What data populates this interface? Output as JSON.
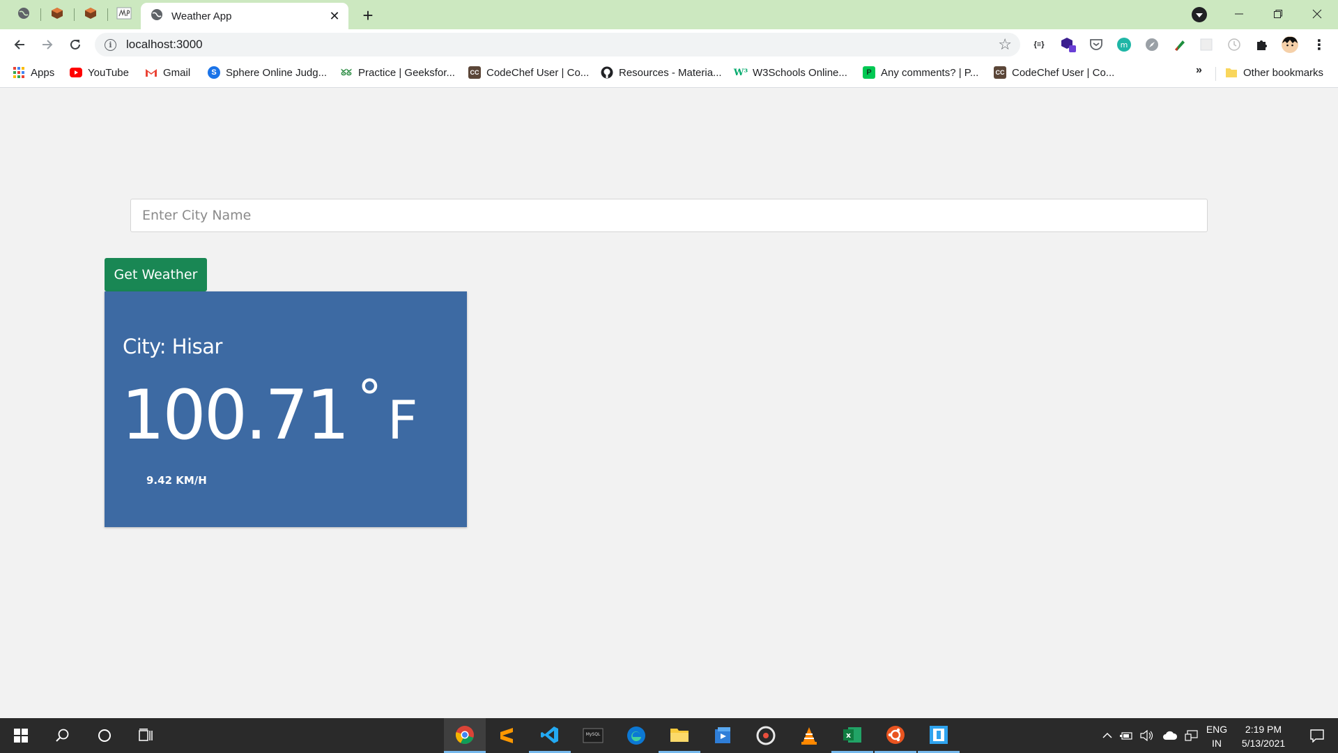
{
  "browser": {
    "active_tab_title": "Weather App",
    "new_tab_symbol": "+",
    "close_symbol": "✕",
    "url": "localhost:3000"
  },
  "bookmarks": {
    "items": [
      {
        "label": "Apps",
        "icon": "apps-grid-icon",
        "color": "#4285f4"
      },
      {
        "label": "YouTube",
        "icon": "youtube-icon",
        "color": "#ff0000"
      },
      {
        "label": "Gmail",
        "icon": "gmail-icon",
        "color": "#ea4335"
      },
      {
        "label": "Sphere Online Judg...",
        "icon": "sphere-judge-icon",
        "color": "#1a73e8"
      },
      {
        "label": "Practice | Geeksfor...",
        "icon": "geeksforgeeks-icon",
        "color": "#2f8d46"
      },
      {
        "label": "CodeChef User | Co...",
        "icon": "codechef-icon",
        "color": "#5b4638"
      },
      {
        "label": "Resources - Materia...",
        "icon": "github-icon",
        "color": "#202124"
      },
      {
        "label": "W3Schools Online...",
        "icon": "w3schools-icon",
        "color": "#04aa6d"
      },
      {
        "label": "Any comments? | P...",
        "icon": "pramp-icon",
        "color": "#00c853"
      },
      {
        "label": "CodeChef User | Co...",
        "icon": "codechef-icon",
        "color": "#5b4638"
      }
    ],
    "overflow_symbol": "»",
    "other_bookmarks": "Other bookmarks"
  },
  "search": {
    "placeholder": "Enter City Name",
    "value": ""
  },
  "actions": {
    "get_weather_label": "Get Weather"
  },
  "weather": {
    "city_label": "City: Hisar",
    "temperature": "100.71",
    "degree_symbol": "°",
    "unit": "F",
    "wind_speed": "9.42 KM/H"
  },
  "taskbar": {
    "language": "ENG",
    "region": "IN",
    "time": "2:19 PM",
    "date": "5/13/2021"
  },
  "colors": {
    "tab_strip": "#cce8c0",
    "button_green": "#198754",
    "card_blue": "#3d6aa3",
    "page_bg": "#f2f2f2",
    "taskbar": "#2a2a2a"
  }
}
